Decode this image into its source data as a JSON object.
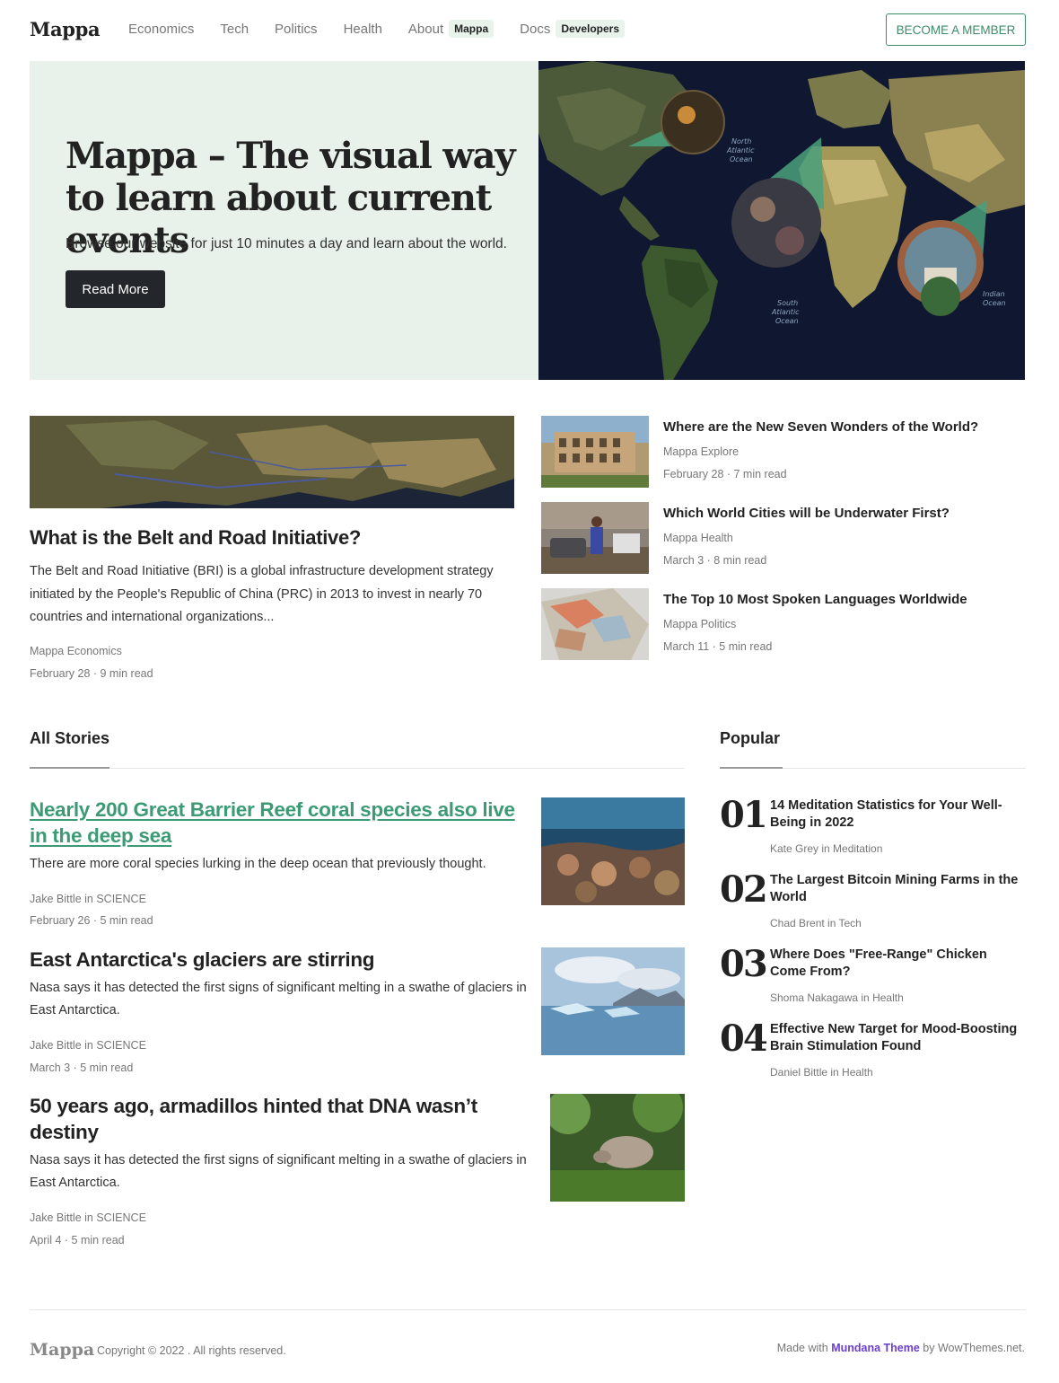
{
  "header": {
    "brand": "Mappa",
    "nav": [
      {
        "label": "Economics"
      },
      {
        "label": "Tech"
      },
      {
        "label": "Politics"
      },
      {
        "label": "Health"
      },
      {
        "label": "About",
        "badge": "Mappa"
      },
      {
        "label": "Docs",
        "badge": "Developers"
      }
    ],
    "cta": "BECOME A MEMBER"
  },
  "hero": {
    "title": "Mappa – The visual way to learn about current events",
    "subtitle": "Browse our website for just 10 minutes a day and learn about the world.",
    "button": "Read More"
  },
  "featured": {
    "title": "What is the Belt and Road Initiative?",
    "excerpt": "The Belt and Road Initiative (BRI) is a global infrastructure development strategy initiated by the People's Republic of China (PRC) in 2013 to invest in nearly 70 countries and international organizations...",
    "author": "Mappa Economics",
    "date": "February 28 · 9 min read"
  },
  "side_posts": [
    {
      "title": "Where are the New Seven Wonders of the World?",
      "author": "Mappa Explore",
      "date": "February 28 · 7 min read"
    },
    {
      "title": "Which World Cities will be Underwater First?",
      "author": "Mappa Health",
      "date": "March 3 · 8 min read"
    },
    {
      "title": "The Top 10 Most Spoken Languages Worldwide",
      "author": "Mappa Politics",
      "date": "March 11 · 5 min read"
    }
  ],
  "all_stories": {
    "heading": "All Stories",
    "items": [
      {
        "title": "Nearly 200 Great Barrier Reef coral species also live in the deep sea",
        "excerpt": "There are more coral species lurking in the deep ocean that previously thought.",
        "author": "Jake Bittle in SCIENCE",
        "date": "February 26 · 5 min read"
      },
      {
        "title": "East Antarctica's glaciers are stirring",
        "excerpt": "Nasa says it has detected the first signs of significant melting in a swathe of glaciers in East Antarctica.",
        "author": "Jake Bittle in SCIENCE",
        "date": "March 3 · 5 min read"
      },
      {
        "title": "50 years ago, armadillos hinted that DNA wasn’t destiny",
        "excerpt": "Nasa says it has detected the first signs of significant melting in a swathe of glaciers in East Antarctica.",
        "author": "Jake Bittle in SCIENCE",
        "date": "April 4 · 5 min read"
      }
    ]
  },
  "popular": {
    "heading": "Popular",
    "items": [
      {
        "num": "01",
        "title": "14 Meditation Statistics for Your Well-Being in 2022",
        "author": "Kate Grey in Meditation"
      },
      {
        "num": "02",
        "title": "The Largest Bitcoin Mining Farms in the World",
        "author": "Chad Brent in Tech"
      },
      {
        "num": "03",
        "title": "Where Does \"Free-Range\" Chicken Come From?",
        "author": "Shoma Nakagawa in Health"
      },
      {
        "num": "04",
        "title": "Effective New Target for Mood-Boosting Brain Stimulation Found",
        "author": "Daniel Bittle in Health"
      }
    ]
  },
  "footer": {
    "brand": "Mappa",
    "copyright": "Copyright © 2022 . All rights reserved.",
    "made_prefix": "Made with",
    "theme": "Mundana Theme",
    "made_suffix": "by WowThemes.net."
  }
}
